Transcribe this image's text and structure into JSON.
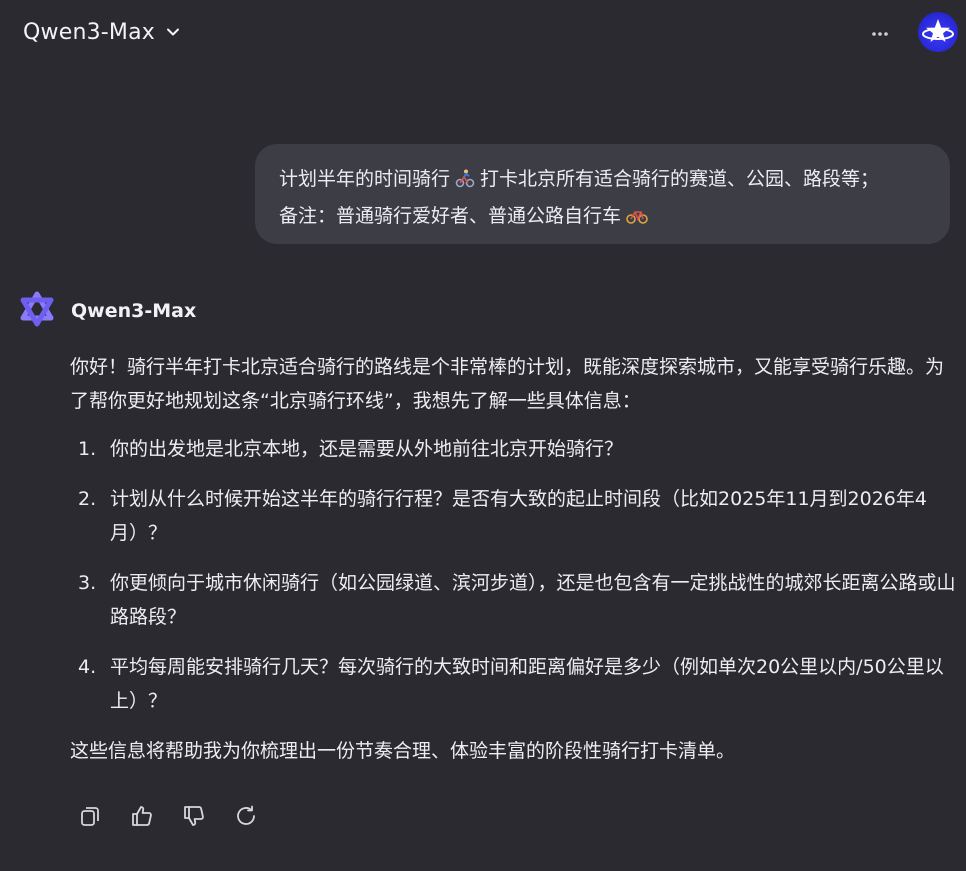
{
  "header": {
    "model_name": "Qwen3-Max",
    "model_dropdown_icon": "chevron-down-icon",
    "more_icon": "more-horizontal-icon",
    "avatar_icon": "star-avatar"
  },
  "user_message": {
    "line1_a": "计划半年的时间骑行",
    "line1_emoji": "person-biking-emoji",
    "line1_b": "打卡北京所有适合骑行的赛道、公园、路段等；",
    "line2_a": "备注：普通骑行爱好者、普通公路自行车",
    "line2_emoji": "bicycle-emoji"
  },
  "assistant": {
    "name": "Qwen3-Max",
    "logo_icon": "qwen-logo-icon",
    "intro": "你好！骑行半年打卡北京适合骑行的路线是个非常棒的计划，既能深度探索城市，又能享受骑行乐趣。为了帮你更好地规划这条“北京骑行环线”，我想先了解一些具体信息：",
    "questions": [
      {
        "num": "1.",
        "text": "你的出发地是北京本地，还是需要从外地前往北京开始骑行？"
      },
      {
        "num": "2.",
        "text": "计划从什么时候开始这半年的骑行行程？是否有大致的起止时间段（比如2025年11月到2026年4月）？"
      },
      {
        "num": "3.",
        "text": "你更倾向于城市休闲骑行（如公园绿道、滨河步道），还是也包含有一定挑战性的城郊长距离公路或山路路段？"
      },
      {
        "num": "4.",
        "text": "平均每周能安排骑行几天？每次骑行的大致时间和距离偏好是多少（例如单次20公里以内/50公里以上）？"
      }
    ],
    "closing": "这些信息将帮助我为你梳理出一份节奏合理、体验丰富的阶段性骑行打卡清单。"
  },
  "actions": [
    {
      "name": "copy-icon"
    },
    {
      "name": "thumbs-up-icon"
    },
    {
      "name": "thumbs-down-icon"
    },
    {
      "name": "regenerate-icon"
    }
  ],
  "colors": {
    "background": "#2a2a30",
    "user_bubble": "#3d3d45",
    "text": "#ececf1",
    "logo": "#7b6cf6",
    "avatar": "#2a2ad8"
  }
}
